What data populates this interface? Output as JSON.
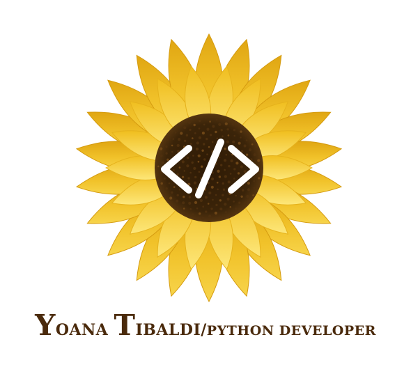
{
  "logo": {
    "icon": "sunflower-code-icon",
    "colors": {
      "petal_outer": "#eab51c",
      "petal_inner": "#fbd84f",
      "center": "#3a2309",
      "seed": "#5b3a14",
      "brackets": "#ffffff",
      "text": "#4a2a0c"
    }
  },
  "caption": {
    "name_first_initial": "Y",
    "name_first_rest": "OANA",
    "name_last_initial": "T",
    "name_last_rest": "IBALDI",
    "separator": "/",
    "role": "PYTHON DEVELOPER"
  }
}
